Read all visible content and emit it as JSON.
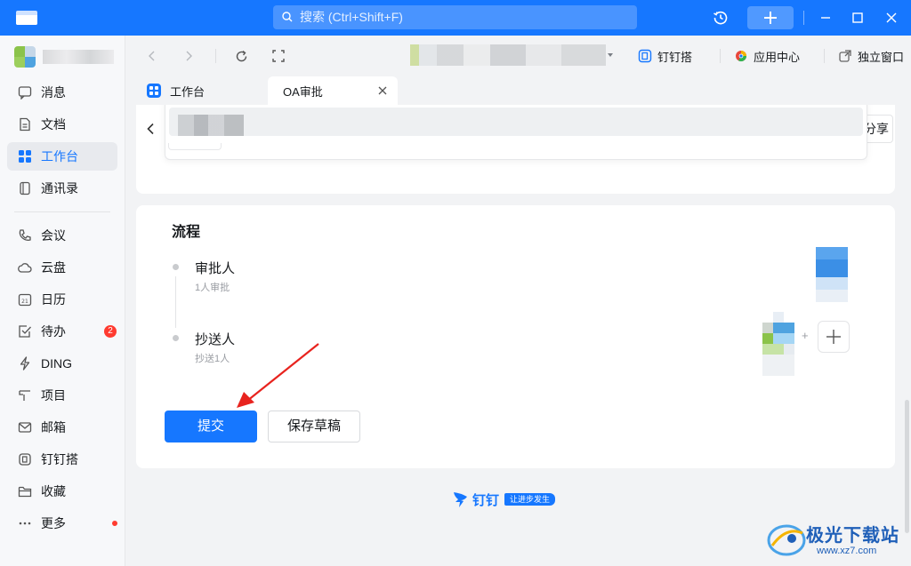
{
  "window": {
    "search_placeholder": "搜索 (Ctrl+Shift+F)"
  },
  "sidebar": {
    "items": [
      {
        "label": "消息",
        "icon": "chat-bubble-icon"
      },
      {
        "label": "文档",
        "icon": "document-icon"
      },
      {
        "label": "工作台",
        "icon": "workbench-grid-icon",
        "active": true
      },
      {
        "label": "通讯录",
        "icon": "contacts-book-icon"
      },
      {
        "label": "会议",
        "icon": "phone-icon"
      },
      {
        "label": "云盘",
        "icon": "cloud-icon"
      },
      {
        "label": "日历",
        "icon": "calendar-icon",
        "icon_text": "21"
      },
      {
        "label": "待办",
        "icon": "todo-check-icon",
        "badge": "2"
      },
      {
        "label": "DING",
        "icon": "lightning-icon"
      },
      {
        "label": "项目",
        "icon": "project-icon"
      },
      {
        "label": "邮箱",
        "icon": "mail-icon"
      },
      {
        "label": "钉钉搭",
        "icon": "dingda-icon"
      },
      {
        "label": "收藏",
        "icon": "folder-icon"
      },
      {
        "label": "更多",
        "icon": "more-dots-icon",
        "dot": true
      }
    ]
  },
  "toolbar": {
    "dingda_label": "钉钉搭",
    "app_center_label": "应用中心",
    "standalone_label": "独立窗口"
  },
  "tabs": [
    {
      "label": "工作台"
    },
    {
      "label": "OA审批"
    }
  ],
  "form": {
    "share_label": "分享",
    "flow_title": "流程",
    "steps": [
      {
        "label": "审批人",
        "sub": "1人审批"
      },
      {
        "label": "抄送人",
        "sub": "抄送1人"
      }
    ],
    "plus_text": "+",
    "submit_label": "提交",
    "draft_label": "保存草稿"
  },
  "footer": {
    "brand": "钉钉",
    "slogan": "让进步发生"
  },
  "watermark": {
    "title": "极光下载站",
    "url": "www.xz7.com"
  },
  "colors": {
    "accent": "#1677ff",
    "badge": "#ff3b30",
    "annotation_arrow": "#e8231e"
  }
}
